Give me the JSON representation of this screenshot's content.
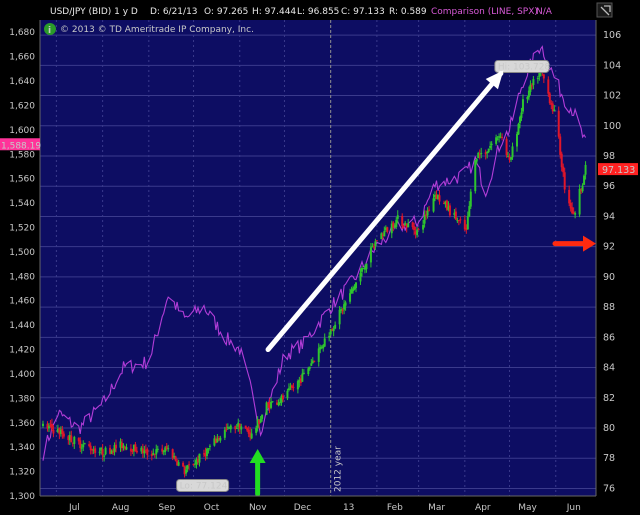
{
  "header": {
    "symbol": "USD/JPY (BID) 1 y D",
    "date": "D: 6/21/13",
    "open": "O: 97.265",
    "high": "H: 97.444",
    "low": "L: 96.855",
    "close": "C: 97.133",
    "range": "R: 0.589",
    "comparison": "Comparison (LINE, SPX)",
    "na": "N/A",
    "settings_icon": "settings-icon"
  },
  "copyright": "© 2013 © TD Ameritrade IP Company, Inc.",
  "info_icon": "info-icon",
  "colors": {
    "background": "#0d0d63",
    "grid": "#3a3a8c",
    "up": "#2ec52e",
    "down": "#e0162a",
    "comparison": "#b23dd8",
    "arrow_white": "#ffffff",
    "arrow_green": "#22dd22",
    "arrow_red": "#ff2a10",
    "current_price_box": "#ff2222",
    "spx_box": "#ff3399"
  },
  "chart_data": {
    "type": "candlestick",
    "title": "USD/JPY (BID) 1 y D",
    "left_axis": {
      "label": "SPX",
      "ylim": [
        1300,
        1690
      ],
      "ticks": [
        "1,680",
        "1,660",
        "1,640",
        "1,620",
        "1,600",
        "1,580",
        "1,560",
        "1,540",
        "1,520",
        "1,500",
        "1,480",
        "1,460",
        "1,440",
        "1,420",
        "1,400",
        "1,380",
        "1,360",
        "1,340",
        "1,320",
        "1,300"
      ]
    },
    "right_axis": {
      "label": "USD/JPY",
      "ylim": [
        75.5,
        107
      ],
      "ticks": [
        "106",
        "104",
        "102",
        "100",
        "98",
        "96",
        "94",
        "92",
        "90",
        "88",
        "86",
        "84",
        "82",
        "80",
        "78",
        "76"
      ]
    },
    "x_axis": {
      "ticks": [
        "Jul",
        "Aug",
        "Sep",
        "Oct",
        "Nov",
        "Dec",
        "13",
        "Feb",
        "Mar",
        "Apr",
        "May",
        "Jun"
      ],
      "year_marker": "2012 year"
    },
    "usdjpy_close_path": [
      [
        "2012-06-22",
        80.1
      ],
      [
        "2012-07-02",
        79.8
      ],
      [
        "2012-07-16",
        79.0
      ],
      [
        "2012-08-01",
        78.4
      ],
      [
        "2012-08-15",
        78.9
      ],
      [
        "2012-09-01",
        78.3
      ],
      [
        "2012-09-14",
        78.6
      ],
      [
        "2012-09-25",
        77.12
      ],
      [
        "2012-10-08",
        78.3
      ],
      [
        "2012-10-22",
        79.8
      ],
      [
        "2012-11-01",
        80.2
      ],
      [
        "2012-11-09",
        79.5
      ],
      [
        "2012-11-19",
        81.5
      ],
      [
        "2012-12-01",
        82.0
      ],
      [
        "2012-12-14",
        83.5
      ],
      [
        "2013-01-01",
        86.5
      ],
      [
        "2013-01-15",
        89.0
      ],
      [
        "2013-02-01",
        92.5
      ],
      [
        "2013-02-15",
        93.8
      ],
      [
        "2013-03-01",
        93.0
      ],
      [
        "2013-03-12",
        95.5
      ],
      [
        "2013-03-25",
        94.0
      ],
      [
        "2013-04-02",
        93.0
      ],
      [
        "2013-04-08",
        98.0
      ],
      [
        "2013-04-15",
        98.3
      ],
      [
        "2013-04-25",
        99.5
      ],
      [
        "2013-05-01",
        97.5
      ],
      [
        "2013-05-10",
        101.5
      ],
      [
        "2013-05-22",
        103.72
      ],
      [
        "2013-06-01",
        100.5
      ],
      [
        "2013-06-07",
        96.0
      ],
      [
        "2013-06-13",
        94.0
      ],
      [
        "2013-06-21",
        97.13
      ]
    ],
    "spx_comparison": [
      [
        "2012-06-22",
        1335
      ],
      [
        "2012-07-02",
        1368
      ],
      [
        "2012-07-16",
        1355
      ],
      [
        "2012-08-01",
        1375
      ],
      [
        "2012-08-15",
        1405
      ],
      [
        "2012-09-01",
        1410
      ],
      [
        "2012-09-14",
        1465
      ],
      [
        "2012-09-25",
        1445
      ],
      [
        "2012-10-08",
        1455
      ],
      [
        "2012-10-22",
        1430
      ],
      [
        "2012-11-01",
        1420
      ],
      [
        "2012-11-09",
        1385
      ],
      [
        "2012-11-15",
        1355
      ],
      [
        "2012-12-01",
        1415
      ],
      [
        "2012-12-14",
        1425
      ],
      [
        "2013-01-01",
        1455
      ],
      [
        "2013-01-15",
        1475
      ],
      [
        "2013-02-01",
        1505
      ],
      [
        "2013-02-15",
        1520
      ],
      [
        "2013-03-01",
        1525
      ],
      [
        "2013-03-12",
        1555
      ],
      [
        "2013-03-25",
        1560
      ],
      [
        "2013-04-02",
        1565
      ],
      [
        "2013-04-08",
        1575
      ],
      [
        "2013-04-15",
        1550
      ],
      [
        "2013-04-25",
        1590
      ],
      [
        "2013-05-01",
        1600
      ],
      [
        "2013-05-10",
        1640
      ],
      [
        "2013-05-22",
        1670
      ],
      [
        "2013-06-01",
        1640
      ],
      [
        "2013-06-07",
        1625
      ],
      [
        "2013-06-13",
        1615
      ],
      [
        "2013-06-21",
        1588.19
      ]
    ],
    "annotations": {
      "high_label": "Hi: 103.728",
      "high_value": 103.728,
      "low_label": "Lo: 77.124",
      "low_value": 77.124,
      "current_price": "97.133",
      "current_price_value": 97.133,
      "spx_current": "1,588.19",
      "spx_current_value": 1588.19
    }
  }
}
